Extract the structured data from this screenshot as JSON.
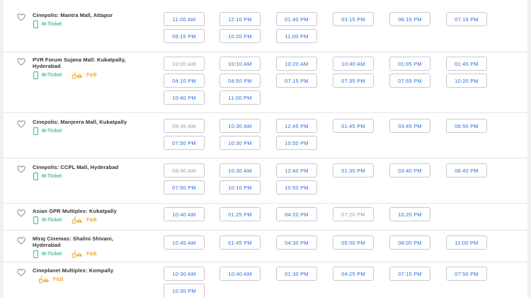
{
  "cinemas": [
    {
      "name": "Cinepolis: Mantra Mall, Attapur",
      "tags": [
        "M-Ticket"
      ],
      "times": [
        {
          "t": "11:00 AM"
        },
        {
          "t": "12:10 PM"
        },
        {
          "t": "01:40 PM"
        },
        {
          "t": "03:15 PM"
        },
        {
          "t": "06:15 PM"
        },
        {
          "t": "07:15 PM"
        },
        {
          "t": "09:15 PM"
        },
        {
          "t": "10:20 PM"
        },
        {
          "t": "11:00 PM"
        }
      ]
    },
    {
      "name": "PVR Forum Sujana Mall: Kukatpally, Hyderabad",
      "tags": [
        "M-Ticket",
        "F&B"
      ],
      "times": [
        {
          "t": "10:00 AM",
          "grey": true
        },
        {
          "t": "10:10 AM"
        },
        {
          "t": "10:20 AM"
        },
        {
          "t": "10:40 AM"
        },
        {
          "t": "01:05 PM"
        },
        {
          "t": "01:45 PM"
        },
        {
          "t": "04:10 PM"
        },
        {
          "t": "04:50 PM"
        },
        {
          "t": "07:15 PM"
        },
        {
          "t": "07:35 PM"
        },
        {
          "t": "07:55 PM"
        },
        {
          "t": "10:20 PM"
        },
        {
          "t": "10:40 PM"
        },
        {
          "t": "11:00 PM"
        }
      ]
    },
    {
      "name": "Cinepolis: Manjeera Mall, Kukatpally",
      "tags": [
        "M-Ticket"
      ],
      "times": [
        {
          "t": "09:45 AM",
          "grey": true
        },
        {
          "t": "10:30 AM"
        },
        {
          "t": "12:45 PM"
        },
        {
          "t": "01:45 PM"
        },
        {
          "t": "03:45 PM"
        },
        {
          "t": "06:50 PM"
        },
        {
          "t": "07:50 PM"
        },
        {
          "t": "10:30 PM"
        },
        {
          "t": "10:50 PM"
        }
      ]
    },
    {
      "name": "Cinepolis: CCPL Mall, Hyderabad",
      "tags": [
        "M-Ticket"
      ],
      "times": [
        {
          "t": "09:40 AM",
          "grey": true
        },
        {
          "t": "10:30 AM"
        },
        {
          "t": "12:40 PM"
        },
        {
          "t": "01:30 PM"
        },
        {
          "t": "03:40 PM"
        },
        {
          "t": "06:40 PM"
        },
        {
          "t": "07:50 PM"
        },
        {
          "t": "10:10 PM"
        },
        {
          "t": "10:50 PM"
        }
      ]
    },
    {
      "name": "Asian GPR Multiplex: Kukatpally",
      "tags": [
        "M-Ticket",
        "F&B"
      ],
      "times": [
        {
          "t": "10:40 AM"
        },
        {
          "t": "01:25 PM"
        },
        {
          "t": "04:20 PM"
        },
        {
          "t": "07:20 PM",
          "grey": true
        },
        {
          "t": "10:20 PM"
        }
      ]
    },
    {
      "name": "Miraj Cinemas: Shalini Shivani, Hyderabad",
      "tags": [
        "M-Ticket",
        "F&B"
      ],
      "times": [
        {
          "t": "10:45 AM"
        },
        {
          "t": "01:45 PM"
        },
        {
          "t": "04:30 PM"
        },
        {
          "t": "05:00 PM"
        },
        {
          "t": "08:00 PM"
        },
        {
          "t": "11:00 PM"
        }
      ]
    },
    {
      "name": "Cineplanet Multiplex: Kompally",
      "tags": [
        "F&B"
      ],
      "times": [
        {
          "t": "10:30 AM"
        },
        {
          "t": "10:40 AM"
        },
        {
          "t": "01:30 PM"
        },
        {
          "t": "04:25 PM"
        },
        {
          "t": "07:15 PM"
        },
        {
          "t": "07:50 PM"
        },
        {
          "t": "10:30 PM"
        }
      ]
    }
  ],
  "colors": {
    "available": "#2d6fd6",
    "filling": "#9a9a9a",
    "mticket": "#49ba8e",
    "fnb": "#f5a623"
  },
  "icons": {
    "favorite": "heart-outline-icon",
    "mticket": "mobile-phone-icon",
    "fnb": "food-beverage-icon"
  }
}
